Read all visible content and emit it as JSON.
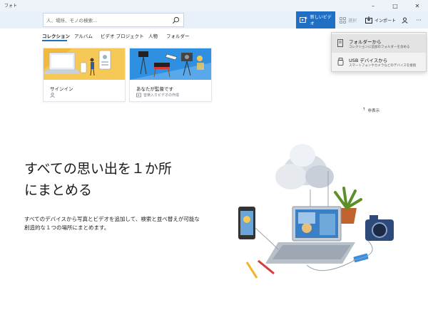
{
  "app": {
    "title": "フォト"
  },
  "window": {
    "minimize": "–",
    "maximize": "□",
    "close": "✕"
  },
  "search": {
    "placeholder": "人、場所、モノの検索..."
  },
  "toolbar": {
    "new_video": "新しいビデオ",
    "select": "選択",
    "import": "インポート",
    "more": "···"
  },
  "tabs": [
    "コレクション",
    "アルバム",
    "ビデオ プロジェクト",
    "人物",
    "フォルダー"
  ],
  "cards": [
    {
      "title": "サインイン",
      "subtitle": ""
    },
    {
      "title": "あなたが監督です",
      "subtitle": "音楽入りビデオの作成"
    }
  ],
  "import_menu": [
    {
      "title": "フォルダーから",
      "description": "コレクションに追加のフォルダーを含める"
    },
    {
      "title": "USB デバイスから",
      "description": "スマートフォンやカメラなどのデバイスを接続"
    }
  ],
  "hide_link": {
    "arrow": "↑",
    "label": "非表示"
  },
  "hero": {
    "title_line1": "すべての思い出を１か所",
    "title_line2": "にまとめる",
    "description": "すべてのデバイスから写真とビデオを追加して、検索と並べ替えが可能な創造的な１つの場所にまとめます。"
  },
  "colors": {
    "accent": "#1f6fc5",
    "header_bg": "#e8f0fa",
    "menu_bg": "#f2f2f2"
  }
}
